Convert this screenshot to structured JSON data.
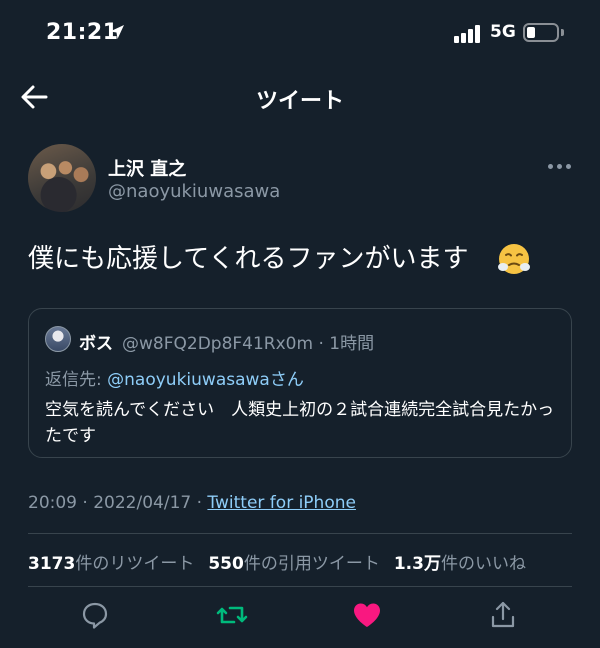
{
  "status_bar": {
    "time": "21:21",
    "network": "5G"
  },
  "nav": {
    "title": "ツイート"
  },
  "author": {
    "display_name": "上沢 直之",
    "username": "@naoyukiuwasawa"
  },
  "tweet": {
    "text": "僕にも応援してくれるファンがいます",
    "emoji": "😤"
  },
  "quote": {
    "name": "ボス",
    "handle_time": "@w8FQ2Dp8F41Rx0m · 1時間",
    "reply_prefix": "返信先: ",
    "reply_mention": "@naoyukiuwasawa",
    "reply_suffix": "さん",
    "body": "空気を読んでください　人類史上初の２試合連続完全試合見たかったです"
  },
  "meta": {
    "time": "20:09",
    "date": "2022/04/17",
    "separator": " · ",
    "source": "Twitter for iPhone"
  },
  "stats": {
    "retweets_count": "3173",
    "retweets_label": "件のリツイート",
    "quotes_count": "550",
    "quotes_label": "件の引用ツイート",
    "likes_count": "1.3万",
    "likes_label": "件のいいね"
  },
  "colors": {
    "background": "#15202b",
    "link": "#8ecdf8",
    "muted": "#8b98a5",
    "retweet": "#00ba7c",
    "like": "#f91880"
  },
  "icons": {
    "back": "arrow-left-icon",
    "more": "more-horizontal-icon",
    "reply": "speech-bubble-icon",
    "retweet": "retweet-icon",
    "like": "heart-icon",
    "share": "share-icon"
  }
}
